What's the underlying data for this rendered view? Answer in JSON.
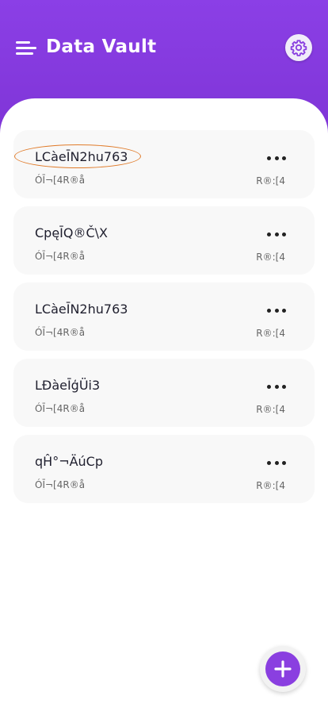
{
  "app": {
    "title": "Data Vault"
  },
  "icons": {
    "menu": "menu-icon",
    "settings": "gear-icon",
    "more": "more-horizontal-icon",
    "add": "plus-icon"
  },
  "colors": {
    "primary": "#8a3fe0",
    "card_bg": "#f8f8f8",
    "highlight": "#e07b2a"
  },
  "items": [
    {
      "title": "LCàeĪN2hu763",
      "subtitle": "ÓĪ¬[4R®å",
      "meta": "R®:[4"
    },
    {
      "title": "CpęĪQ®Č\\X",
      "subtitle": "ÓĪ¬[4R®å",
      "meta": "R®:[4"
    },
    {
      "title": "LCàeĪN2hu763",
      "subtitle": "ÓĪ¬[4R®å",
      "meta": "R®:[4"
    },
    {
      "title": "LĐàeĪģÜi3",
      "subtitle": "ÓĪ¬[4R®å",
      "meta": "R®:[4"
    },
    {
      "title": "qĤ°¬ÄúCp",
      "subtitle": "ÓĪ¬[4R®å",
      "meta": "R®:[4"
    }
  ]
}
